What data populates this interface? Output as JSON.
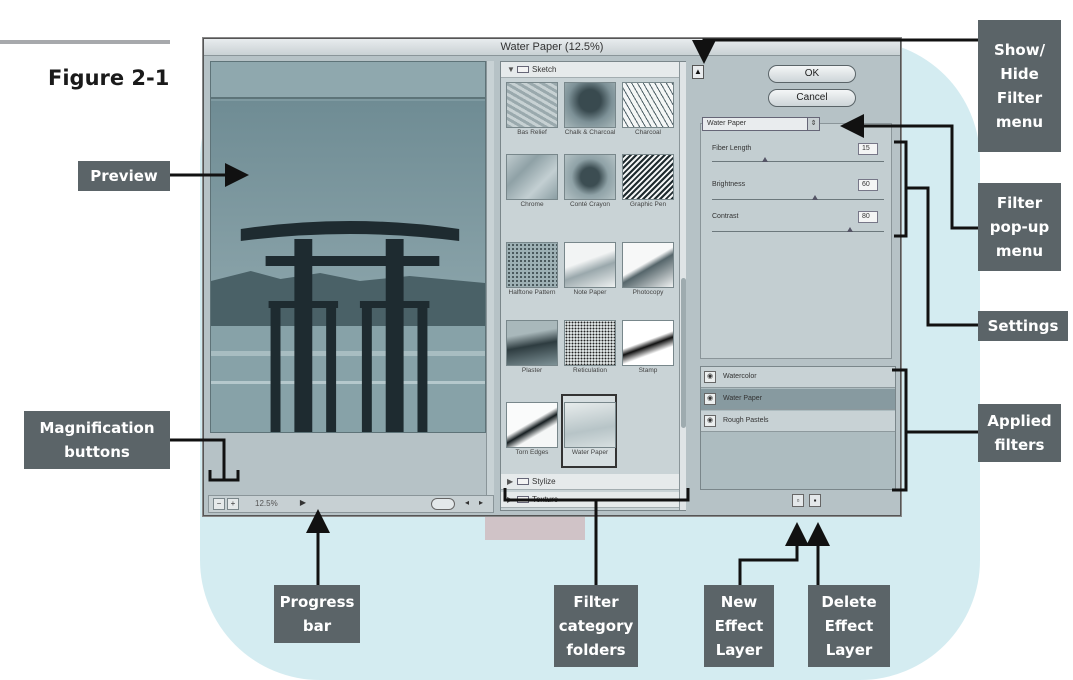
{
  "figure_label": "Figure 2-1",
  "dialog": {
    "title": "Water Paper (12.5%)",
    "zoom_value": "12.5%",
    "ok_label": "OK",
    "cancel_label": "Cancel"
  },
  "browser": {
    "open_folder": "Sketch",
    "thumbnails": [
      "Bas Relief",
      "Chalk & Charcoal",
      "Charcoal",
      "Chrome",
      "Conté Crayon",
      "Graphic Pen",
      "Halftone Pattern",
      "Note Paper",
      "Photocopy",
      "Plaster",
      "Reticulation",
      "Stamp",
      "Torn Edges",
      "Water Paper"
    ],
    "closed_folders": [
      "Stylize",
      "Texture"
    ]
  },
  "settings": {
    "filter_name": "Water Paper",
    "params": [
      {
        "label": "Fiber Length",
        "value": "15",
        "level": 0.31
      },
      {
        "label": "Brightness",
        "value": "60",
        "level": 0.6
      },
      {
        "label": "Contrast",
        "value": "80",
        "level": 0.8
      }
    ]
  },
  "applied_filters": [
    "Watercolor",
    "Water Paper",
    "Rough Pastels"
  ],
  "callouts": {
    "show_hide": "Show/\nHide\nFilter\nmenu",
    "preview": "Preview",
    "filter_popup": "Filter\npop-up\nmenu",
    "settings": "Settings",
    "applied": "Applied\nfilters",
    "magnification": "Magnification\nbuttons",
    "progress": "Progress\nbar",
    "category": "Filter\ncategory\nfolders",
    "new_layer": "New\nEffect\nLayer",
    "delete_layer": "Delete\nEffect\nLayer"
  },
  "colors": {
    "callout_bg": "#5b6468",
    "watermark": "#cde9ef",
    "dialog_bg": "#b6c2c6"
  }
}
